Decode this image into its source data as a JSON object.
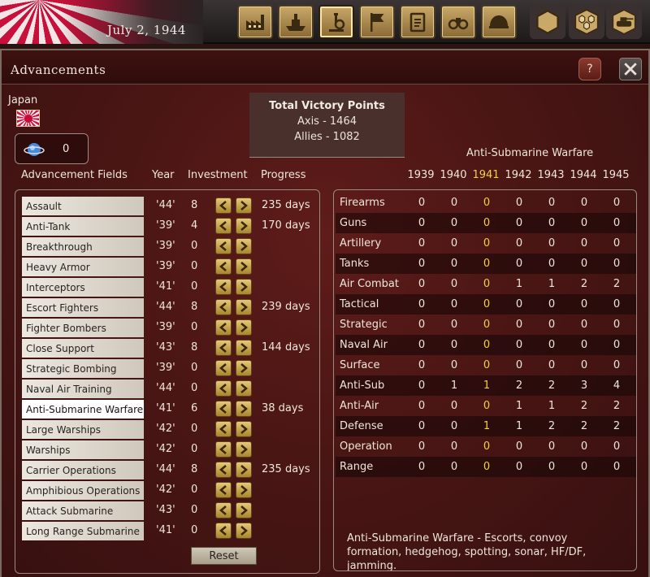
{
  "topbar": {
    "date": "July 2, 1944",
    "buttons": [
      {
        "icon": "factory-icon"
      },
      {
        "icon": "ship-icon"
      },
      {
        "icon": "microscope-icon"
      },
      {
        "icon": "flag-icon"
      },
      {
        "icon": "clipboard-icon"
      },
      {
        "icon": "binoculars-icon"
      },
      {
        "icon": "helmet-icon"
      },
      {
        "icon": "hex-icon"
      },
      {
        "icon": "hex-cluster-icon"
      },
      {
        "icon": "tank-icon"
      }
    ],
    "active_button": "microscope-icon"
  },
  "dialog": {
    "title": "Advancements",
    "help_label": "?",
    "country": "Japan",
    "research_points": "0",
    "victory_points": {
      "title": "Total Victory Points",
      "axis": "Axis - 1464",
      "allies": "Allies - 1082"
    },
    "headers": {
      "fields": "Advancement Fields",
      "year": "Year",
      "investment": "Investment",
      "progress": "Progress"
    },
    "fields": [
      {
        "name": "Assault",
        "year": "'44'",
        "investment": "8",
        "progress": "235 days"
      },
      {
        "name": "Anti-Tank",
        "year": "'39'",
        "investment": "4",
        "progress": "170 days"
      },
      {
        "name": "Breakthrough",
        "year": "'39'",
        "investment": "0",
        "progress": ""
      },
      {
        "name": "Heavy Armor",
        "year": "'39'",
        "investment": "0",
        "progress": ""
      },
      {
        "name": "Interceptors",
        "year": "'41'",
        "investment": "0",
        "progress": ""
      },
      {
        "name": "Escort Fighters",
        "year": "'44'",
        "investment": "8",
        "progress": "239 days"
      },
      {
        "name": "Fighter Bombers",
        "year": "'39'",
        "investment": "0",
        "progress": ""
      },
      {
        "name": "Close Support",
        "year": "'43'",
        "investment": "8",
        "progress": "144 days"
      },
      {
        "name": "Strategic Bombing",
        "year": "'39'",
        "investment": "0",
        "progress": ""
      },
      {
        "name": "Naval Air Training",
        "year": "'44'",
        "investment": "0",
        "progress": ""
      },
      {
        "name": "Anti-Submarine Warfare",
        "year": "'41'",
        "investment": "6",
        "progress": "38 days"
      },
      {
        "name": "Large Warships",
        "year": "'42'",
        "investment": "0",
        "progress": ""
      },
      {
        "name": "Warships",
        "year": "'42'",
        "investment": "0",
        "progress": ""
      },
      {
        "name": "Carrier Operations",
        "year": "'44'",
        "investment": "8",
        "progress": "235 days"
      },
      {
        "name": "Amphibious Operations",
        "year": "'42'",
        "investment": "0",
        "progress": ""
      },
      {
        "name": "Attack Submarine",
        "year": "'43'",
        "investment": "0",
        "progress": ""
      },
      {
        "name": "Long Range Submarine",
        "year": "'41'",
        "investment": "0",
        "progress": ""
      }
    ],
    "selected_field_index": 10,
    "reset_label": "Reset",
    "detail": {
      "title": "Anti-Submarine Warfare",
      "years": [
        "1939",
        "1940",
        "1941",
        "1942",
        "1943",
        "1944",
        "1945"
      ],
      "highlight_year_index": 2,
      "rows": [
        {
          "label": "Firearms",
          "values": [
            "0",
            "0",
            "0",
            "0",
            "0",
            "0",
            "0"
          ]
        },
        {
          "label": "Guns",
          "values": [
            "0",
            "0",
            "0",
            "0",
            "0",
            "0",
            "0"
          ]
        },
        {
          "label": "Artillery",
          "values": [
            "0",
            "0",
            "0",
            "0",
            "0",
            "0",
            "0"
          ]
        },
        {
          "label": "Tanks",
          "values": [
            "0",
            "0",
            "0",
            "0",
            "0",
            "0",
            "0"
          ]
        },
        {
          "label": "Air Combat",
          "values": [
            "0",
            "0",
            "0",
            "1",
            "1",
            "2",
            "2"
          ]
        },
        {
          "label": "Tactical",
          "values": [
            "0",
            "0",
            "0",
            "0",
            "0",
            "0",
            "0"
          ]
        },
        {
          "label": "Strategic",
          "values": [
            "0",
            "0",
            "0",
            "0",
            "0",
            "0",
            "0"
          ]
        },
        {
          "label": "Naval Air",
          "values": [
            "0",
            "0",
            "0",
            "0",
            "0",
            "0",
            "0"
          ]
        },
        {
          "label": "Surface",
          "values": [
            "0",
            "0",
            "0",
            "0",
            "0",
            "0",
            "0"
          ]
        },
        {
          "label": "Anti-Sub",
          "values": [
            "0",
            "1",
            "1",
            "2",
            "2",
            "3",
            "4"
          ]
        },
        {
          "label": "Anti-Air",
          "values": [
            "0",
            "0",
            "0",
            "1",
            "1",
            "2",
            "2"
          ]
        },
        {
          "label": "Defense",
          "values": [
            "0",
            "0",
            "1",
            "1",
            "2",
            "2",
            "2"
          ]
        },
        {
          "label": "Operation",
          "values": [
            "0",
            "0",
            "0",
            "0",
            "0",
            "0",
            "0"
          ]
        },
        {
          "label": "Range",
          "values": [
            "0",
            "0",
            "0",
            "0",
            "0",
            "0",
            "0"
          ]
        }
      ],
      "description": "Anti-Submarine Warfare - Escorts, convoy formation, hedgehog, spotting, sonar, HF/DF, jamming."
    }
  },
  "colors": {
    "highlight": "#f2d23a",
    "dialog_bg": "#4a1614",
    "button_gold": "#c9a868"
  }
}
